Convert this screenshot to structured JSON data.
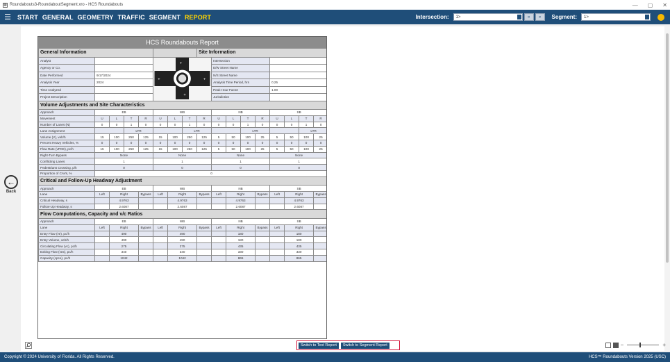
{
  "window": {
    "title": "Roundabouts3-RoundaboutSegment.xro - HCS Roundabouts",
    "minimize": "—",
    "maximize": "▢",
    "close": "✕"
  },
  "menu": {
    "items": [
      "START",
      "GENERAL",
      "GEOMETRY",
      "TRAFFIC",
      "SEGMENT",
      "REPORT"
    ],
    "active": "REPORT",
    "intersection_label": "Intersection:",
    "intersection_value": "1>",
    "segment_label": "Segment:",
    "segment_value": "1>",
    "prev_btn": "«",
    "next_btn": "»"
  },
  "back": {
    "label": "Back"
  },
  "report": {
    "title": "HCS Roundabouts Report",
    "general_header": "General Information",
    "site_header": "Site Information",
    "general": [
      {
        "label": "Analyst",
        "value": ""
      },
      {
        "label": "Agency or Co.",
        "value": ""
      },
      {
        "label": "Date Performed",
        "value": "9/17/2024"
      },
      {
        "label": "Analysis Year",
        "value": "2024"
      },
      {
        "label": "Time Analyzed",
        "value": ""
      },
      {
        "label": "Project Description",
        "value": ""
      }
    ],
    "site": [
      {
        "label": "Intersection",
        "value": ""
      },
      {
        "label": "E/W Street Name",
        "value": ""
      },
      {
        "label": "N/S Street Name",
        "value": ""
      },
      {
        "label": "Analysis Time Period, hrs",
        "value": "0.25"
      },
      {
        "label": "Peak Hour Factor",
        "value": "1.00"
      },
      {
        "label": "Jurisdiction",
        "value": ""
      }
    ],
    "volume_header": "Volume Adjustments and Site Characteristics",
    "approach_label": "Approach",
    "approaches": [
      "EB",
      "WB",
      "NB",
      "SB"
    ],
    "movement_label": "Movement",
    "movements": [
      "U",
      "L",
      "T",
      "R"
    ],
    "lanes_label": "Number of Lanes (N)",
    "lanes": [
      [
        "0",
        "0",
        "1",
        "0"
      ],
      [
        "0",
        "0",
        "1",
        "0"
      ],
      [
        "0",
        "0",
        "1",
        "0"
      ],
      [
        "0",
        "0",
        "1",
        "0"
      ]
    ],
    "lane_assign_label": "Lane Assignment",
    "lane_assign": [
      "LTR",
      "LTR",
      "LTR",
      "LTR"
    ],
    "volume_label": "Volume (V), veh/h",
    "volume": [
      [
        "15",
        "100",
        "250",
        "125"
      ],
      [
        "15",
        "100",
        "250",
        "125"
      ],
      [
        "5",
        "50",
        "100",
        "25"
      ],
      [
        "5",
        "50",
        "100",
        "25"
      ]
    ],
    "hv_label": "Percent Heavy Vehicles, %",
    "hv": [
      [
        "0",
        "0",
        "0",
        "0"
      ],
      [
        "0",
        "0",
        "0",
        "0"
      ],
      [
        "0",
        "0",
        "0",
        "0"
      ],
      [
        "0",
        "0",
        "0",
        "0"
      ]
    ],
    "flow_label": "Flow Rate (vPCE), pc/h",
    "flow": [
      [
        "15",
        "100",
        "250",
        "125"
      ],
      [
        "15",
        "100",
        "250",
        "125"
      ],
      [
        "5",
        "50",
        "100",
        "25"
      ],
      [
        "5",
        "50",
        "100",
        "25"
      ]
    ],
    "rtb_label": "Right-Turn Bypass",
    "rtb": [
      "None",
      "None",
      "None",
      "None"
    ],
    "conflicting_label": "Conflicting Lanes",
    "conflicting": [
      "1",
      "1",
      "1",
      "1"
    ],
    "ped_label": "Pedestrians Crossing, p/h",
    "ped": [
      "0",
      "0",
      "0",
      "0"
    ],
    "cav_label": "Proportion of CAVs, %",
    "cav": "0",
    "headway_header": "Critical and Follow-Up Headway Adjustment",
    "lane_label": "Lane",
    "lane_cols": [
      "Left",
      "Right",
      "Bypass"
    ],
    "crit_label": "Critical Headway, s",
    "crit": [
      "4.9763",
      "4.9763",
      "4.9763",
      "4.9763"
    ],
    "follow_label": "Follow-Up Headway, s",
    "follow": [
      "2.6087",
      "2.6087",
      "2.6087",
      "2.6087"
    ],
    "flowcomp_header": "Flow Computations, Capacity and v/c Ratios",
    "entry_flow_label": "Entry Flow (ve), pc/h",
    "entry_flow": [
      "490",
      "490",
      "180",
      "180"
    ],
    "entry_vol_label": "Entry Volume, veh/h",
    "entry_vol": [
      "490",
      "490",
      "180",
      "180"
    ],
    "circ_label": "Circulating Flow (vc), pc/h",
    "circ": [
      "275",
      "275",
      "435",
      "435"
    ],
    "exit_label": "Exiting Flow (vex), pc/h",
    "exit": [
      "340",
      "340",
      "330",
      "330"
    ],
    "cap_label": "Capacity (cpce), pc/h",
    "cap": [
      "1042",
      "1042",
      "865",
      "865"
    ]
  },
  "buttons": {
    "text_report": "Switch to Text Report",
    "segment_report": "Switch to Segment Report"
  },
  "footer": {
    "copyright": "Copyright © 2024 University of Florida. All Rights Reserved.",
    "version": "HCS™ Roundabouts Version 2025 (USC)"
  }
}
